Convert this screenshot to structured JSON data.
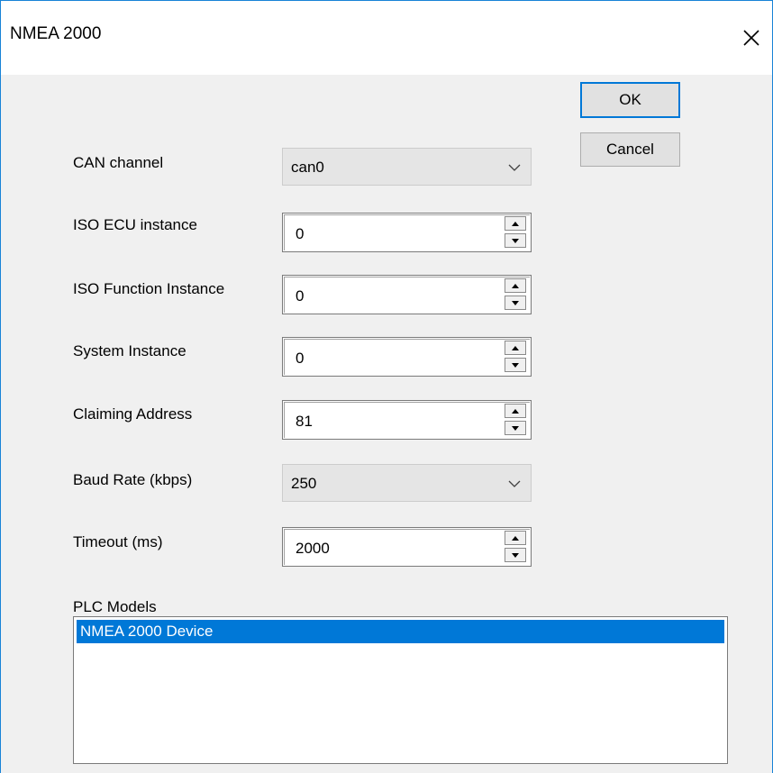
{
  "window": {
    "title": "NMEA 2000"
  },
  "buttons": {
    "ok_label": "OK",
    "cancel_label": "Cancel"
  },
  "fields": {
    "can_channel": {
      "label": "CAN channel",
      "value": "can0"
    },
    "iso_ecu_instance": {
      "label": "ISO ECU instance",
      "value": "0"
    },
    "iso_function_instance": {
      "label": "ISO Function Instance",
      "value": "0"
    },
    "system_instance": {
      "label": "System Instance",
      "value": "0"
    },
    "claiming_address": {
      "label": "Claiming Address",
      "value": "81"
    },
    "baud_rate": {
      "label": "Baud Rate (kbps)",
      "value": "250"
    },
    "timeout": {
      "label": "Timeout (ms)",
      "value": "2000"
    }
  },
  "plc_models": {
    "label": "PLC Models",
    "items": [
      {
        "label": "NMEA 2000 Device",
        "selected": true
      }
    ]
  },
  "colors": {
    "accent": "#0078d7",
    "window_border": "#1883d7",
    "dialog_bg": "#f0f0f0"
  }
}
